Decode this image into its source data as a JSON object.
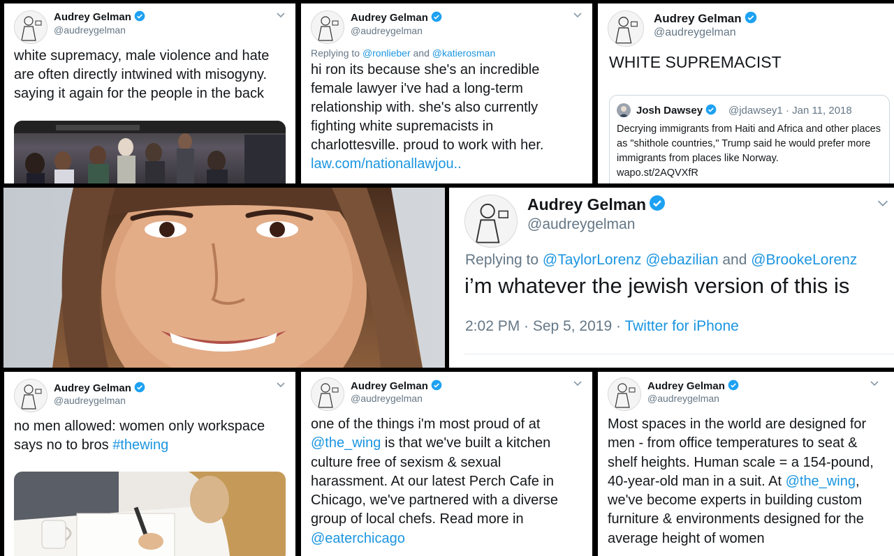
{
  "colors": {
    "link": "#1b95e0",
    "verified": "#1da1f2",
    "muted": "#657786",
    "text": "#14171a"
  },
  "tweets": [
    {
      "name": "Audrey Gelman",
      "handle": "@audreygelman",
      "text": "white supremacy, male violence and hate are often directly intwined with misogyny. saying it again for the people in the back",
      "media": "crowd-photo"
    },
    {
      "name": "Audrey Gelman",
      "handle": "@audreygelman",
      "reply_prefix": "Replying to ",
      "reply_user1": "@ronlieber",
      "reply_and": " and ",
      "reply_user2": "@katierosman",
      "text": "hi ron its because she's an incredible female lawyer i've had a long-term relationship with. she's also currently fighting white supremacists in charlottesville. proud to work with her.",
      "link": "law.com/nationallawjou.."
    },
    {
      "name": "Audrey Gelman",
      "handle": "@audreygelman",
      "text": "WHITE SUPREMACIST",
      "quote": {
        "name": "Josh Dawsey",
        "handle": "@jdawsey1",
        "date": "· Jan 11, 2018",
        "text": "Decrying immigrants from Haiti and Africa and other places as \"shithole countries,\" Trump said he would prefer more immigrants from places like Norway.",
        "link": "wapo.st/2AQVXfR"
      }
    },
    {
      "name": "Audrey Gelman",
      "handle": "@audreygelman",
      "reply_prefix": "Replying to ",
      "reply_user1": "@TaylorLorenz",
      "reply_user2": "@ebazilian",
      "reply_and": " and ",
      "reply_user3": "@BrookeLorenz",
      "text": "i’m whatever the jewish version of this is",
      "time": "2:02 PM · Sep 5, 2019 ·",
      "source": "Twitter for iPhone"
    },
    {
      "name": "Audrey Gelman",
      "handle": "@audreygelman",
      "text": "no men allowed: women only workspace says no to bros",
      "hashtag": "#thewing",
      "media": "workspace-photo"
    },
    {
      "name": "Audrey Gelman",
      "handle": "@audreygelman",
      "text_a": "one of the things i'm most proud of at ",
      "mention": "@the_wing",
      "text_b": " is that we've built a kitchen culture free of sexism & sexual harassment. At our latest Perch Cafe in Chicago, we've partnered with a diverse group of local chefs. Read more in ",
      "mention2": "@eaterchicago"
    },
    {
      "name": "Audrey Gelman",
      "handle": "@audreygelman",
      "text_a": "Most spaces in the world are designed for men - from office temperatures to seat & shelf heights. Human scale = a 154-pound, 40-year-old man in a suit. At ",
      "mention": "@the_wing",
      "text_b": ", we've become experts in building custom furniture & environments designed for the average height of women"
    }
  ],
  "portrait": {
    "subject": "smiling woman with long brown hair"
  }
}
